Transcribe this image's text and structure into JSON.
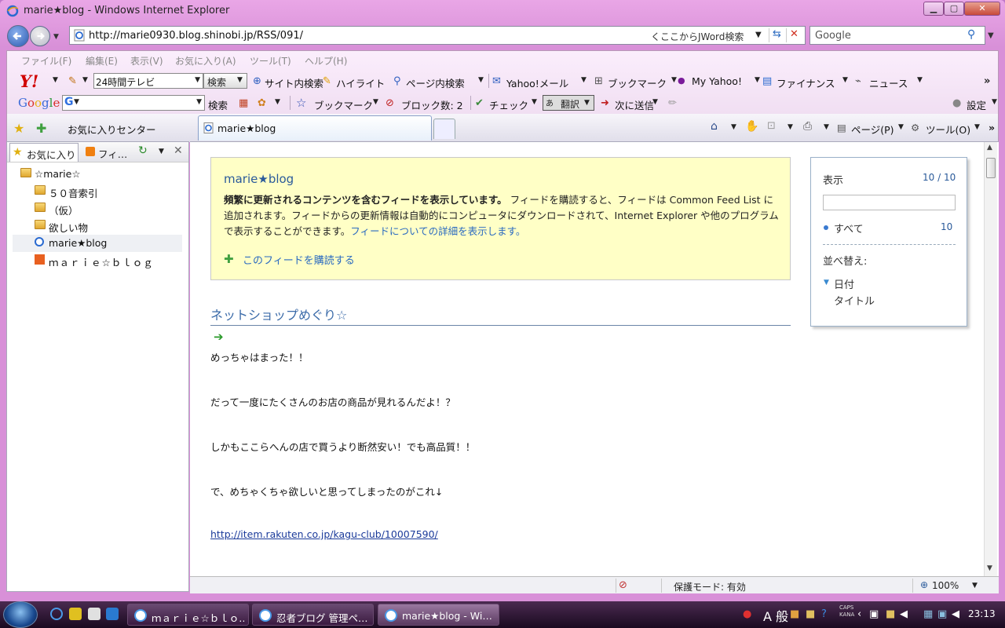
{
  "window": {
    "title": "marie★blog - Windows Internet Explorer"
  },
  "address": {
    "url": "http://marie0930.blog.shinobi.jp/RSS/091/",
    "jword_hint": "くここからJWord検索",
    "search_placeholder": "Google"
  },
  "menu": [
    "ファイル(F)",
    "編集(E)",
    "表示(V)",
    "お気に入り(A)",
    "ツール(T)",
    "ヘルプ(H)"
  ],
  "yahoo_toolbar": {
    "logo": "Y!",
    "combo_value": "24時間テレビ",
    "search_btn": "検索",
    "site_search": "サイト内検索",
    "highlight": "ハイライト",
    "page_search": "ページ内検索",
    "mail": "Yahoo!メール",
    "bookmark": "ブックマーク",
    "my_yahoo": "My Yahoo!",
    "finance": "ファイナンス",
    "news": "ニュース"
  },
  "google_toolbar": {
    "logo": "Google",
    "search_btn": "検索",
    "bookmark": "ブックマーク",
    "block_count": "ブロック数: 2",
    "check": "チェック",
    "translate": "翻訳",
    "send": "次に送信",
    "settings": "設定"
  },
  "fav_bar": {
    "fav_center": "お気に入りセンター",
    "tab_label": "marie★blog",
    "page_menu": "ページ(P)",
    "tools_menu": "ツール(O)"
  },
  "fav_pane": {
    "tab_fav": "お気に入り",
    "tab_feeds": "フィ…",
    "items": [
      {
        "label": "☆marie☆",
        "type": "folder"
      },
      {
        "label": "５０音索引",
        "type": "folder"
      },
      {
        "label": "（仮）",
        "type": "folder"
      },
      {
        "label": "欲しい物",
        "type": "folder"
      },
      {
        "label": "marie★blog",
        "type": "page"
      },
      {
        "label": "ｍａｒｉｅ☆ｂｌｏｇ",
        "type": "blog"
      }
    ]
  },
  "feed_info": {
    "title": "marie★blog",
    "bold": "頻繁に更新されるコンテンツを含むフィードを表示しています。",
    "body": " フィードを購読すると、フィードは Common Feed List に追加されます。フィードからの更新情報は自動的にコンピュータにダウンロードされて、Internet Explorer や他のプログラムで表示することができます。",
    "detail_link": "フィードについての詳細を表示します。",
    "subscribe": "このフィードを購読する"
  },
  "feed_item": {
    "title": "ネットショップめぐり☆",
    "lines": [
      "めっちゃはまった！！",
      "だって一度にたくさんのお店の商品が見れるんだよ！？",
      "しかもここらへんの店で買うより断然安い！でも高品質！！",
      "で、めちゃくちゃ欲しいと思ってしまったのがこれ↓"
    ],
    "link": "http://item.rakuten.co.jp/kagu-club/10007590/"
  },
  "sidebox": {
    "show_label": "表示",
    "show_count": "10 / 10",
    "all_label": "すべて",
    "all_count": "10",
    "sort_label": "並べ替え:",
    "sort_date": "日付",
    "sort_title": "タイトル"
  },
  "statusbar": {
    "protect": "保護モード: 有効",
    "zoom": "100%"
  },
  "taskbar": {
    "buttons": [
      "ｍａｒｉｅ☆ｂｌｏ…",
      "忍者ブログ 管理ペ…",
      "marie★blog - Wi…"
    ],
    "ime": "A 般",
    "caps": "CAPS",
    "kana": "KANA",
    "clock": "23:13"
  },
  "colors": {
    "frame": "#d890d8",
    "link": "#2a6ac0",
    "infobox_bg": "#ffffc6"
  }
}
